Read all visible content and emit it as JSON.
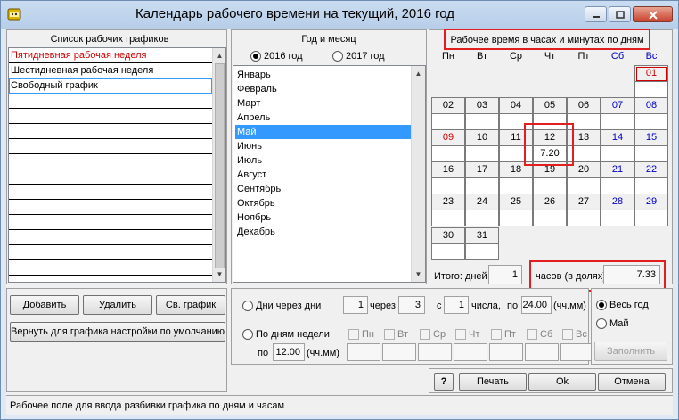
{
  "window": {
    "title": "Календарь рабочего времени на текущий, 2016 год"
  },
  "schedules": {
    "header": "Список рабочих графиков",
    "items": [
      "Пятидневная рабочая неделя",
      "Шестидневная рабочая неделя",
      "Свободный график"
    ],
    "item_colors": [
      "#d00000",
      "#000000",
      "#000000"
    ]
  },
  "period": {
    "header": "Год и месяц",
    "year1": "2016 год",
    "year2": "2017 год",
    "months": [
      "Январь",
      "Февраль",
      "Март",
      "Апрель",
      "Май",
      "Июнь",
      "Июль",
      "Август",
      "Сентябрь",
      "Октябрь",
      "Ноябрь",
      "Декабрь"
    ],
    "selected_month": "Май"
  },
  "calendar": {
    "header": "Рабочее время в часах и минутах по дням",
    "weekdays": [
      "Пн",
      "Вт",
      "Ср",
      "Чт",
      "Пт",
      "Сб",
      "Вс"
    ],
    "weeks": [
      [
        null,
        null,
        null,
        null,
        null,
        null,
        {
          "d": "01",
          "h": ""
        }
      ],
      [
        {
          "d": "02",
          "h": ""
        },
        {
          "d": "03",
          "h": ""
        },
        {
          "d": "04",
          "h": ""
        },
        {
          "d": "05",
          "h": ""
        },
        {
          "d": "06",
          "h": ""
        },
        {
          "d": "07",
          "h": ""
        },
        {
          "d": "08",
          "h": ""
        }
      ],
      [
        {
          "d": "09",
          "h": ""
        },
        {
          "d": "10",
          "h": ""
        },
        {
          "d": "11",
          "h": ""
        },
        {
          "d": "12",
          "h": "7.20"
        },
        {
          "d": "13",
          "h": ""
        },
        {
          "d": "14",
          "h": ""
        },
        {
          "d": "15",
          "h": ""
        }
      ],
      [
        {
          "d": "16",
          "h": ""
        },
        {
          "d": "17",
          "h": ""
        },
        {
          "d": "18",
          "h": ""
        },
        {
          "d": "19",
          "h": ""
        },
        {
          "d": "20",
          "h": ""
        },
        {
          "d": "21",
          "h": ""
        },
        {
          "d": "22",
          "h": ""
        }
      ],
      [
        {
          "d": "23",
          "h": ""
        },
        {
          "d": "24",
          "h": ""
        },
        {
          "d": "25",
          "h": ""
        },
        {
          "d": "26",
          "h": ""
        },
        {
          "d": "27",
          "h": ""
        },
        {
          "d": "28",
          "h": ""
        },
        {
          "d": "29",
          "h": ""
        }
      ],
      [
        {
          "d": "30",
          "h": ""
        },
        {
          "d": "31",
          "h": ""
        },
        null,
        null,
        null,
        null,
        null
      ]
    ],
    "holiday_days": [
      "01",
      "09"
    ],
    "weekend_days": [
      "07",
      "08",
      "14",
      "15",
      "21",
      "22",
      "28",
      "29"
    ],
    "totals": {
      "days_label": "Итого: дней",
      "days_value": "1",
      "hours_label": "часов (в долях)",
      "hours_value": "7.33"
    }
  },
  "buttons": {
    "add": "Добавить",
    "delete": "Удалить",
    "free": "Св. график",
    "reset": "Вернуть для графика настройки по умолчанию",
    "help": "?",
    "print": "Печать",
    "ok": "Ok",
    "cancel": "Отмена",
    "fill": "Заполнить"
  },
  "fill_mode": {
    "every_n": {
      "label": "Дни через дни",
      "days": "1",
      "through_label": "через",
      "through": "3",
      "from_label": "с",
      "from": "1",
      "number_label": "числа,",
      "by_label": "по",
      "hours": "24.00",
      "unit": "(чч.мм)"
    },
    "by_weekday": {
      "label": "По дням недели",
      "days": [
        "Пн",
        "Вт",
        "Ср",
        "Чт",
        "Пт",
        "Сб",
        "Вс"
      ],
      "by_label": "по",
      "hours": "12.00",
      "unit": "(чч.мм)"
    }
  },
  "scope": {
    "whole_year": "Весь год",
    "month": "Май"
  },
  "status": "Рабочее поле для ввода разбивки графика по дням и часам",
  "colors": {
    "holiday": "#d00000",
    "weekend": "#0000c8",
    "selection": "#3399ff",
    "highlight": "#e02020"
  }
}
